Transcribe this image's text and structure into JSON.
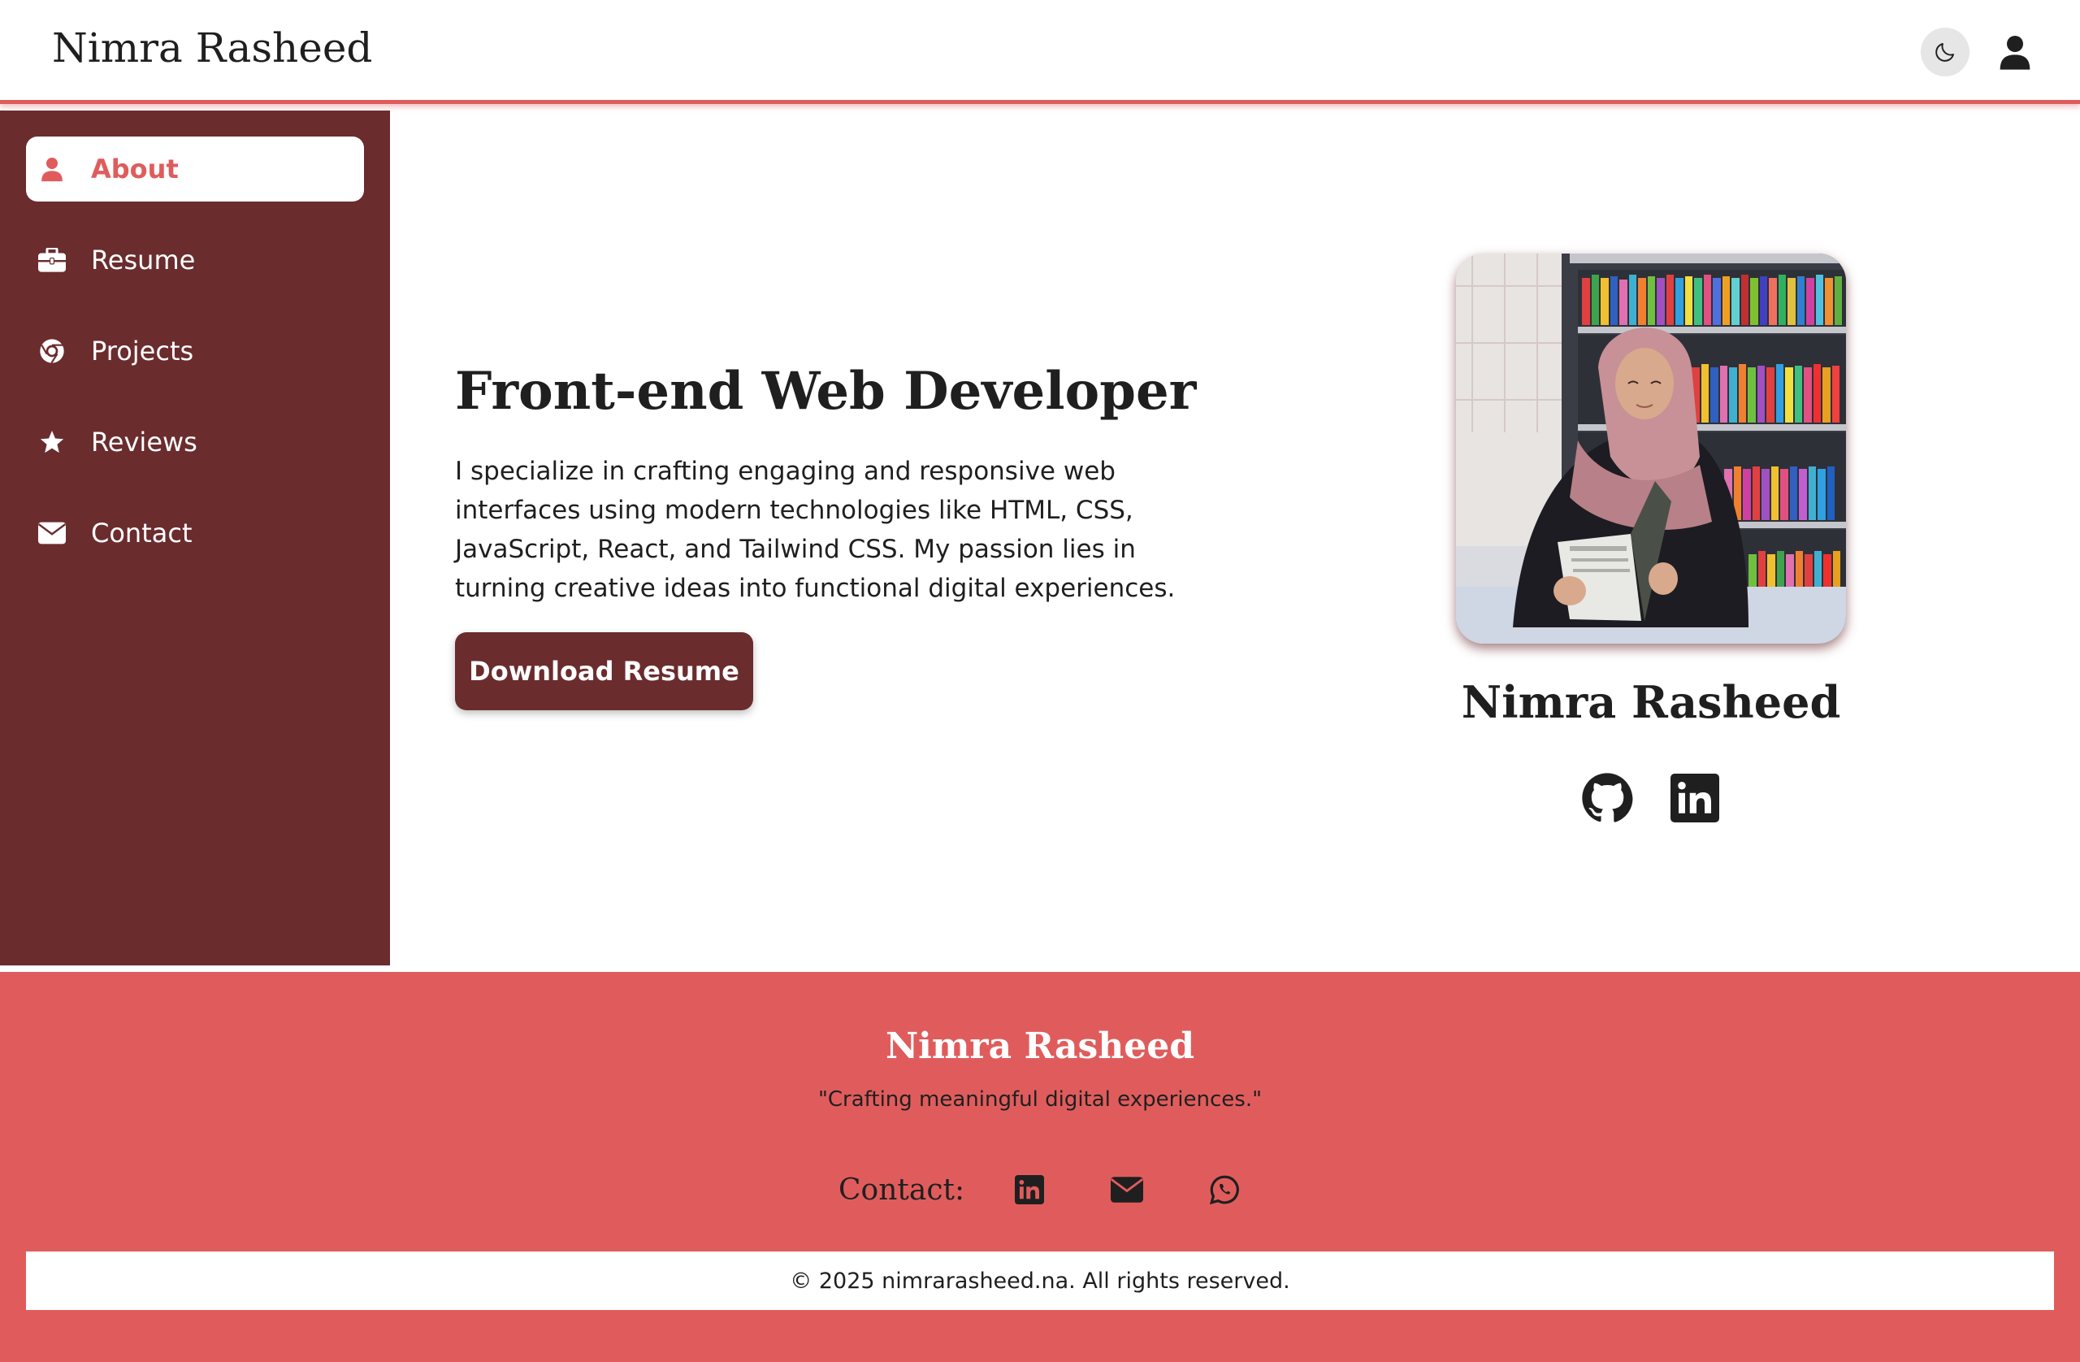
{
  "header": {
    "brand": "Nimra Rasheed",
    "icons": {
      "theme_toggle": "moon-icon",
      "account": "user-icon"
    }
  },
  "sidebar": {
    "items": [
      {
        "label": "About",
        "icon": "user-icon",
        "active": true
      },
      {
        "label": "Resume",
        "icon": "briefcase-icon",
        "active": false
      },
      {
        "label": "Projects",
        "icon": "chrome-icon",
        "active": false
      },
      {
        "label": "Reviews",
        "icon": "star-icon",
        "active": false
      },
      {
        "label": "Contact",
        "icon": "envelope-icon",
        "active": false
      }
    ]
  },
  "hero": {
    "title": "Front-end Web Developer",
    "description": "I specialize in crafting engaging and responsive web interfaces using modern technologies like HTML, CSS, JavaScript, React, and Tailwind CSS. My passion lies in turning creative ideas into functional digital experiences.",
    "button_label": "Download Resume"
  },
  "profile": {
    "name": "Nimra Rasheed",
    "socials": [
      "github-icon",
      "linkedin-icon"
    ]
  },
  "footer": {
    "name": "Nimra Rasheed",
    "tagline": "\"Crafting meaningful digital experiences.\"",
    "contact_label": "Contact:",
    "contact_icons": [
      "linkedin-icon",
      "envelope-icon",
      "whatsapp-icon"
    ],
    "copyright": "© 2025 nimrarasheed.na. All rights reserved."
  },
  "colors": {
    "accent": "#e05c5c",
    "sidebar": "#6b2c2e",
    "text": "#1f1f1f"
  }
}
